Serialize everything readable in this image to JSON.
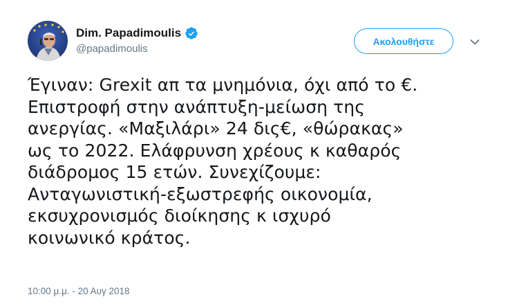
{
  "user": {
    "display_name": "Dim. Papadimoulis",
    "handle": "@papadimoulis",
    "verified_icon": "verified-badge-icon",
    "avatar_icon": "profile-photo"
  },
  "follow_button": {
    "label": "Ακολουθήστε"
  },
  "menu_caret": {
    "icon": "chevron-down-icon"
  },
  "tweet": {
    "text": "Έγιναν: Grexit απ τα μνημόνια, όχι από το €.\nΕπιστροφή στην ανάπτυξη-μείωση της\nανεργίας. «Μαξιλάρι» 24 δις€, «θώρακας»\nως το 2022. Ελάφρυνση χρέους κ καθαρός\nδιάδρομος 15 ετών. Συνεχίζουμε:\nΑνταγωνιστική-εξωστρεφής οικονομία,\nεκσυχρονισμός διοίκησης κ ισχυρό\nκοινωνικό κράτος.",
    "timestamp": "10:00 μ.μ. - 20 Αυγ 2018"
  },
  "colors": {
    "accent": "#1da1f2",
    "text": "#14171a",
    "muted": "#657786"
  }
}
